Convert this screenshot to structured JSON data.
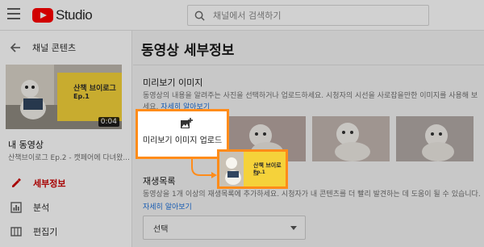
{
  "header": {
    "logo_text": "Studio",
    "search_placeholder": "채널에서 검색하기"
  },
  "sidebar": {
    "back_label": "채널 콘텐츠",
    "video": {
      "thumb_title": "산책 브이로그",
      "thumb_sub": "Ep.1",
      "duration": "0:04",
      "title": "내 동영상",
      "subtitle": "산책브이로그 Ep.2 - 캣페어에 다녀왔..."
    },
    "nav": [
      {
        "label": "세부정보",
        "icon": "pencil-icon",
        "active": true
      },
      {
        "label": "분석",
        "icon": "analytics-icon",
        "active": false
      },
      {
        "label": "편집기",
        "icon": "editor-icon",
        "active": false
      }
    ]
  },
  "main": {
    "title": "동영상 세부정보",
    "thumbnail": {
      "heading": "미리보기 이미지",
      "desc": "동영상의 내용을 알려주는 사진을 선택하거나 업로드하세요. 시청자의 시선을 사로잡을만한 이미지를 사용해 보세요.",
      "link": "자세히 알아보기",
      "upload_label": "미리보기 이미지 업로드"
    },
    "playlist": {
      "heading": "재생목록",
      "desc": "동영상을 1개 이상의 재생목록에 추가하세요. 시청자가 내 콘텐츠를 더 빨리 발견하는 데 도움이 될 수 있습니다.",
      "link": "자세히 알아보기",
      "select_value": "선택"
    },
    "preview": {
      "title": "산책 브이로그",
      "sub": "Ep.1"
    }
  },
  "colors": {
    "accent": "#ff8c1a",
    "brand_red": "#ff0000",
    "link_blue": "#1a6ed8",
    "active_red": "#cc0000"
  }
}
